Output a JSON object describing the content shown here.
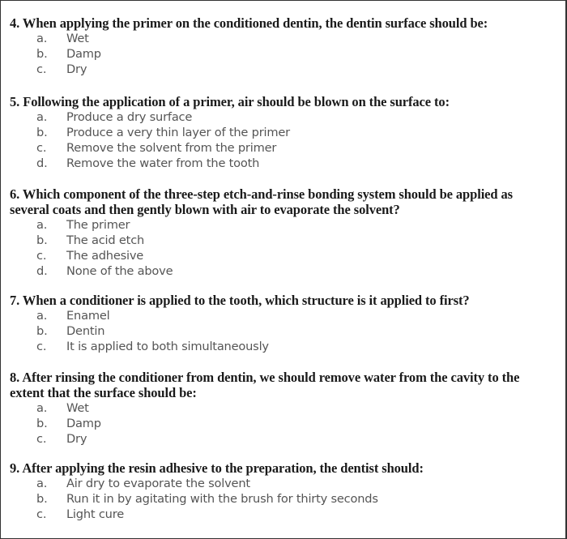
{
  "questions": [
    {
      "number": "4.",
      "text": "When applying the primer on the conditioned dentin, the dentin surface should be:",
      "options": [
        {
          "letter": "a.",
          "text": "Wet"
        },
        {
          "letter": "b.",
          "text": "Damp"
        },
        {
          "letter": "c.",
          "text": "Dry"
        }
      ]
    },
    {
      "number": "5.",
      "text": "Following the application of a primer, air should be blown on the surface to:",
      "options": [
        {
          "letter": "a.",
          "text": "Produce a dry surface"
        },
        {
          "letter": "b.",
          "text": "Produce a very thin layer of the primer"
        },
        {
          "letter": "c.",
          "text": "Remove the solvent from the primer"
        },
        {
          "letter": "d.",
          "text": "Remove the water from the tooth"
        }
      ]
    },
    {
      "number": "6.",
      "text": "Which component of the three-step etch-and-rinse bonding system should be applied as several coats and then gently blown with air to evaporate the solvent?",
      "options": [
        {
          "letter": "a.",
          "text": "The primer"
        },
        {
          "letter": "b.",
          "text": "The acid etch"
        },
        {
          "letter": "c.",
          "text": "The adhesive"
        },
        {
          "letter": "d.",
          "text": "None of the above"
        }
      ]
    },
    {
      "number": "7.",
      "text": "When a conditioner is applied to the tooth, which structure is it applied to first?",
      "options": [
        {
          "letter": "a.",
          "text": "Enamel"
        },
        {
          "letter": "b.",
          "text": "Dentin"
        },
        {
          "letter": "c.",
          "text": "It is applied to both simultaneously"
        }
      ]
    },
    {
      "number": "8.",
      "text": "After rinsing the conditioner from dentin, we should remove water from the cavity to the extent that the surface should be:",
      "options": [
        {
          "letter": "a.",
          "text": "Wet"
        },
        {
          "letter": "b.",
          "text": "Damp"
        },
        {
          "letter": "c.",
          "text": "Dry"
        }
      ]
    },
    {
      "number": "9.",
      "text": "After applying the resin adhesive to the preparation, the dentist should:",
      "options": [
        {
          "letter": "a.",
          "text": "Air dry to evaporate the solvent"
        },
        {
          "letter": "b.",
          "text": "Run it in by agitating with the brush for thirty seconds"
        },
        {
          "letter": "c.",
          "text": "Light cure"
        }
      ]
    }
  ]
}
